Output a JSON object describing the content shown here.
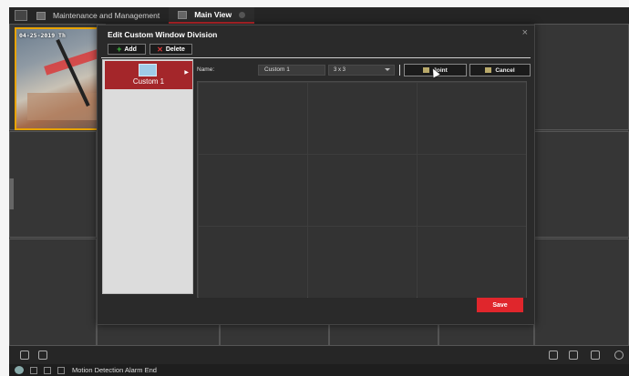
{
  "tabs": [
    {
      "label": "Maintenance and Management",
      "active": false
    },
    {
      "label": "Main View",
      "active": true
    }
  ],
  "camera": {
    "timestamp": "04-25-2019 Th"
  },
  "dialog": {
    "title": "Edit Custom Window Division",
    "add_label": "Add",
    "delete_label": "Delete",
    "list_items": [
      {
        "label": "Custom 1"
      }
    ],
    "name_label": "Name:",
    "name_value": "Custom 1",
    "division_value": "3 x 3",
    "joint_label": "Joint",
    "cancel_label": "Cancel",
    "save_label": "Save"
  },
  "status": {
    "message": "Motion Detection Alarm End"
  },
  "colors": {
    "accent": "#e0262c",
    "selected_item": "#a4262a",
    "camera_border": "#e8a300"
  }
}
